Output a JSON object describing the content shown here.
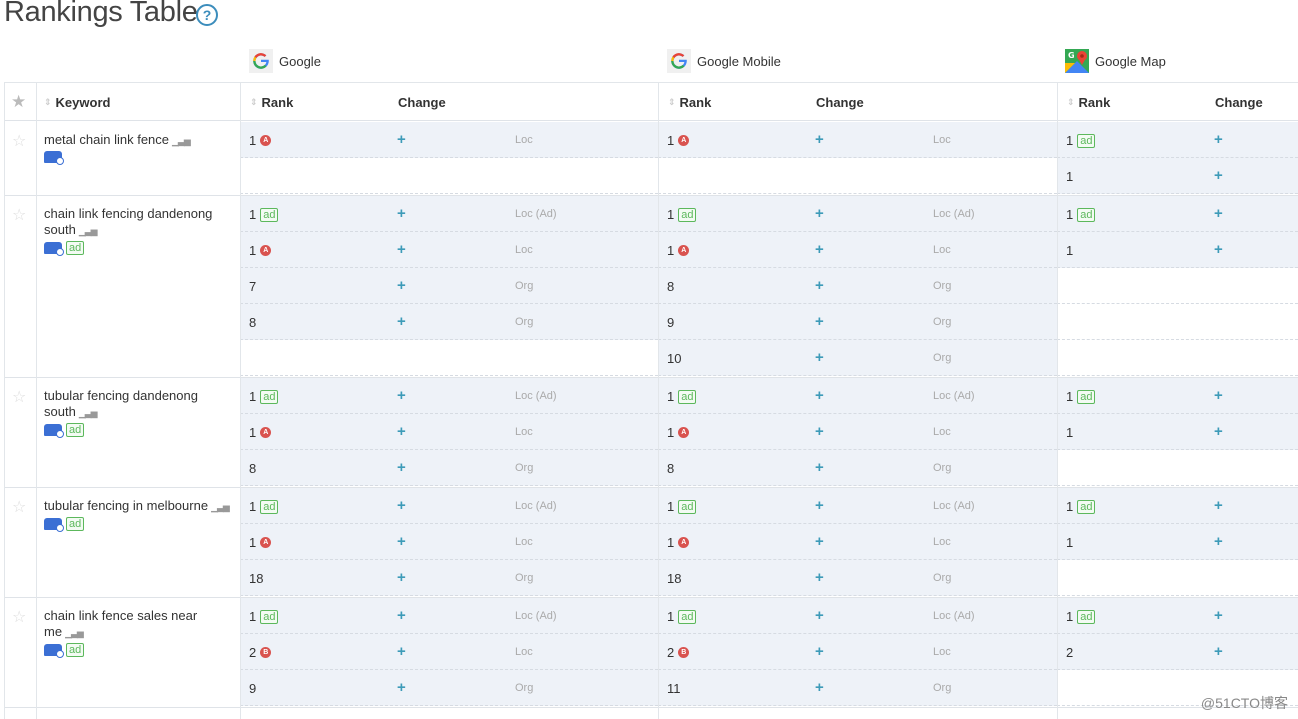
{
  "page": {
    "title": "Rankings Table",
    "help_icon": "question-circle-icon",
    "watermark": "@51CTO博客"
  },
  "engines": [
    {
      "name": "Google",
      "icon": "google-g-icon"
    },
    {
      "name": "Google Mobile",
      "icon": "google-g-icon"
    },
    {
      "name": "Google Map",
      "icon": "google-maps-icon"
    }
  ],
  "headers": {
    "keyword": "Keyword",
    "rank": "Rank",
    "change": "Change"
  },
  "keywords": [
    {
      "text": "metal chain link fence",
      "ad_badge": false,
      "google": [
        {
          "rank": "1",
          "marker": "A",
          "type": "Loc"
        }
      ],
      "mobile": [
        {
          "rank": "1",
          "marker": "A",
          "type": "Loc"
        }
      ],
      "map": [
        {
          "rank": "1",
          "ad": true
        },
        {
          "rank": "1"
        }
      ]
    },
    {
      "text": "chain link fencing dandenong south",
      "ad_badge": true,
      "google": [
        {
          "rank": "1",
          "ad": true,
          "type": "Loc (Ad)"
        },
        {
          "rank": "1",
          "marker": "A",
          "type": "Loc"
        },
        {
          "rank": "7",
          "type": "Org"
        },
        {
          "rank": "8",
          "type": "Org"
        }
      ],
      "mobile": [
        {
          "rank": "1",
          "ad": true,
          "type": "Loc (Ad)"
        },
        {
          "rank": "1",
          "marker": "A",
          "type": "Loc"
        },
        {
          "rank": "8",
          "type": "Org"
        },
        {
          "rank": "9",
          "type": "Org"
        },
        {
          "rank": "10",
          "type": "Org"
        }
      ],
      "map": [
        {
          "rank": "1",
          "ad": true
        },
        {
          "rank": "1"
        }
      ]
    },
    {
      "text": "tubular fencing dandenong south",
      "ad_badge": true,
      "google": [
        {
          "rank": "1",
          "ad": true,
          "type": "Loc (Ad)"
        },
        {
          "rank": "1",
          "marker": "A",
          "type": "Loc"
        },
        {
          "rank": "8",
          "type": "Org"
        }
      ],
      "mobile": [
        {
          "rank": "1",
          "ad": true,
          "type": "Loc (Ad)"
        },
        {
          "rank": "1",
          "marker": "A",
          "type": "Loc"
        },
        {
          "rank": "8",
          "type": "Org"
        }
      ],
      "map": [
        {
          "rank": "1",
          "ad": true
        },
        {
          "rank": "1"
        }
      ]
    },
    {
      "text": "tubular fencing in melbourne",
      "ad_badge": true,
      "google": [
        {
          "rank": "1",
          "ad": true,
          "type": "Loc (Ad)"
        },
        {
          "rank": "1",
          "marker": "A",
          "type": "Loc"
        },
        {
          "rank": "18",
          "type": "Org"
        }
      ],
      "mobile": [
        {
          "rank": "1",
          "ad": true,
          "type": "Loc (Ad)"
        },
        {
          "rank": "1",
          "marker": "A",
          "type": "Loc"
        },
        {
          "rank": "18",
          "type": "Org"
        }
      ],
      "map": [
        {
          "rank": "1",
          "ad": true
        },
        {
          "rank": "1"
        }
      ]
    },
    {
      "text": "chain link fence sales near me",
      "ad_badge": true,
      "google": [
        {
          "rank": "1",
          "ad": true,
          "type": "Loc (Ad)"
        },
        {
          "rank": "2",
          "marker": "B",
          "type": "Loc"
        },
        {
          "rank": "9",
          "type": "Org"
        }
      ],
      "mobile": [
        {
          "rank": "1",
          "ad": true,
          "type": "Loc (Ad)"
        },
        {
          "rank": "2",
          "marker": "B",
          "type": "Loc"
        },
        {
          "rank": "11",
          "type": "Org"
        }
      ],
      "map": [
        {
          "rank": "1",
          "ad": true
        },
        {
          "rank": "2"
        }
      ]
    }
  ],
  "labels": {
    "ad": "ad",
    "change_icon": "+"
  }
}
